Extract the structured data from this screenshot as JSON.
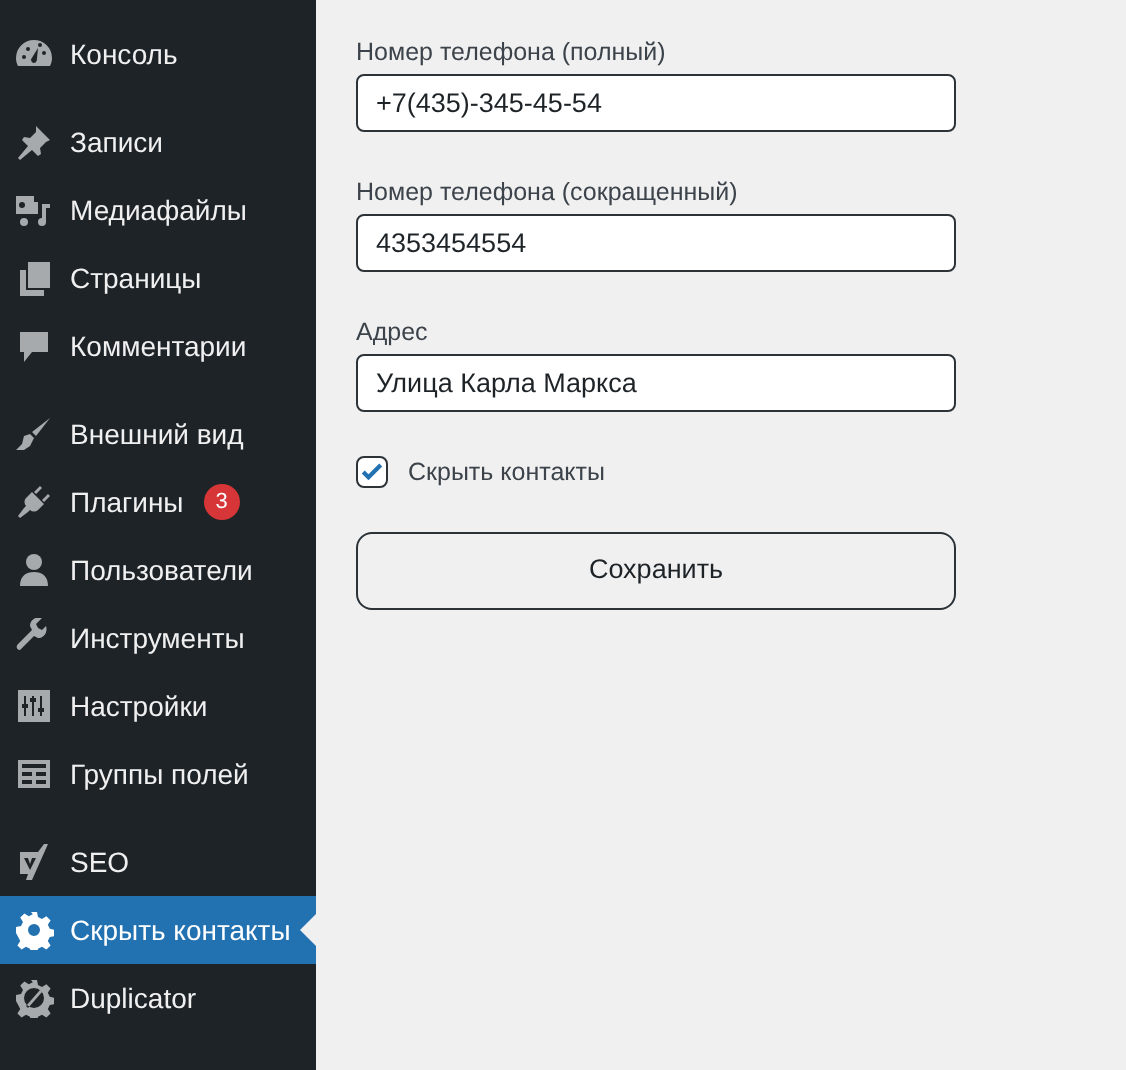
{
  "sidebar": {
    "groups": [
      {
        "items": [
          {
            "label": "Консоль",
            "kind": "gauge",
            "selected": false
          }
        ]
      },
      {
        "items": [
          {
            "label": "Записи",
            "kind": "pin",
            "selected": false
          },
          {
            "label": "Медиафайлы",
            "kind": "media",
            "selected": false
          },
          {
            "label": "Страницы",
            "kind": "pages",
            "selected": false
          },
          {
            "label": "Комментарии",
            "kind": "comment",
            "selected": false
          }
        ]
      },
      {
        "items": [
          {
            "label": "Внешний вид",
            "kind": "brush",
            "selected": false
          },
          {
            "label": "Плагины",
            "kind": "plug",
            "selected": false,
            "badge": "3"
          },
          {
            "label": "Пользователи",
            "kind": "user",
            "selected": false
          },
          {
            "label": "Инструменты",
            "kind": "wrench",
            "selected": false
          },
          {
            "label": "Настройки",
            "kind": "sliders",
            "selected": false
          },
          {
            "label": "Группы полей",
            "kind": "table",
            "selected": false
          }
        ]
      },
      {
        "items": [
          {
            "label": "SEO",
            "kind": "seo",
            "selected": false
          },
          {
            "label": "Скрыть контакты",
            "kind": "gear",
            "selected": true
          },
          {
            "label": "Duplicator",
            "kind": "gearslash",
            "selected": false
          }
        ]
      }
    ]
  },
  "form": {
    "fields": [
      {
        "label": "Номер телефона (полный)",
        "value": "+7(435)-345-45-54"
      },
      {
        "label": "Номер телефона (сокращенный)",
        "value": "4353454554"
      },
      {
        "label": "Адрес",
        "value": "Улица Карла Маркса"
      }
    ],
    "checkbox": {
      "label": "Скрыть контакты",
      "checked": true
    },
    "button": "Сохранить"
  }
}
